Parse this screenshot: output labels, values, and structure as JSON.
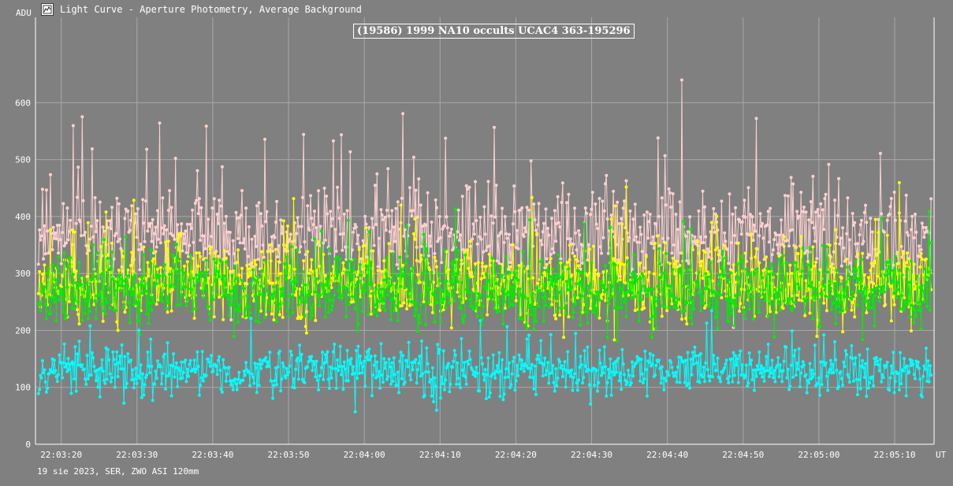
{
  "window": {
    "title": "Light Curve - Aperture Photometry, Average Background",
    "icon": "light-curve-app-icon"
  },
  "chart_data": {
    "type": "line",
    "title": "(19586) 1999 NA10 occults UCAC4 363-195296",
    "ylabel": "ADU",
    "xlabel": "UT",
    "ylim": [
      0,
      750
    ],
    "yticks": [
      0,
      100,
      200,
      300,
      400,
      500,
      600
    ],
    "xticks": [
      "22:03:20",
      "22:03:30",
      "22:03:40",
      "22:03:50",
      "22:04:00",
      "22:04:10",
      "22:04:20",
      "22:04:30",
      "22:04:40",
      "22:04:50",
      "22:05:00",
      "22:05:10"
    ],
    "x_range_seconds": [
      16.6,
      135.2
    ],
    "grid": true,
    "legend": "none",
    "series": [
      {
        "color": "#ffd0d0",
        "mean": 365,
        "spread": 55,
        "spikes": 120,
        "count": 900,
        "seed": 11
      },
      {
        "color": "#ffff00",
        "mean": 285,
        "spread": 45,
        "spikes": 70,
        "count": 900,
        "seed": 23
      },
      {
        "color": "#00ee00",
        "mean": 270,
        "spread": 45,
        "spikes": 60,
        "count": 900,
        "seed": 37
      },
      {
        "color": "#00ffff",
        "mean": 130,
        "spread": 28,
        "spikes": 40,
        "count": 900,
        "seed": 53
      }
    ]
  },
  "footer": {
    "text": "19 sie 2023, SER, ZWO ASI 120mm"
  },
  "colors": {
    "background": "#808080",
    "grid": "#a8a8a8",
    "axis": "#ffffff"
  }
}
